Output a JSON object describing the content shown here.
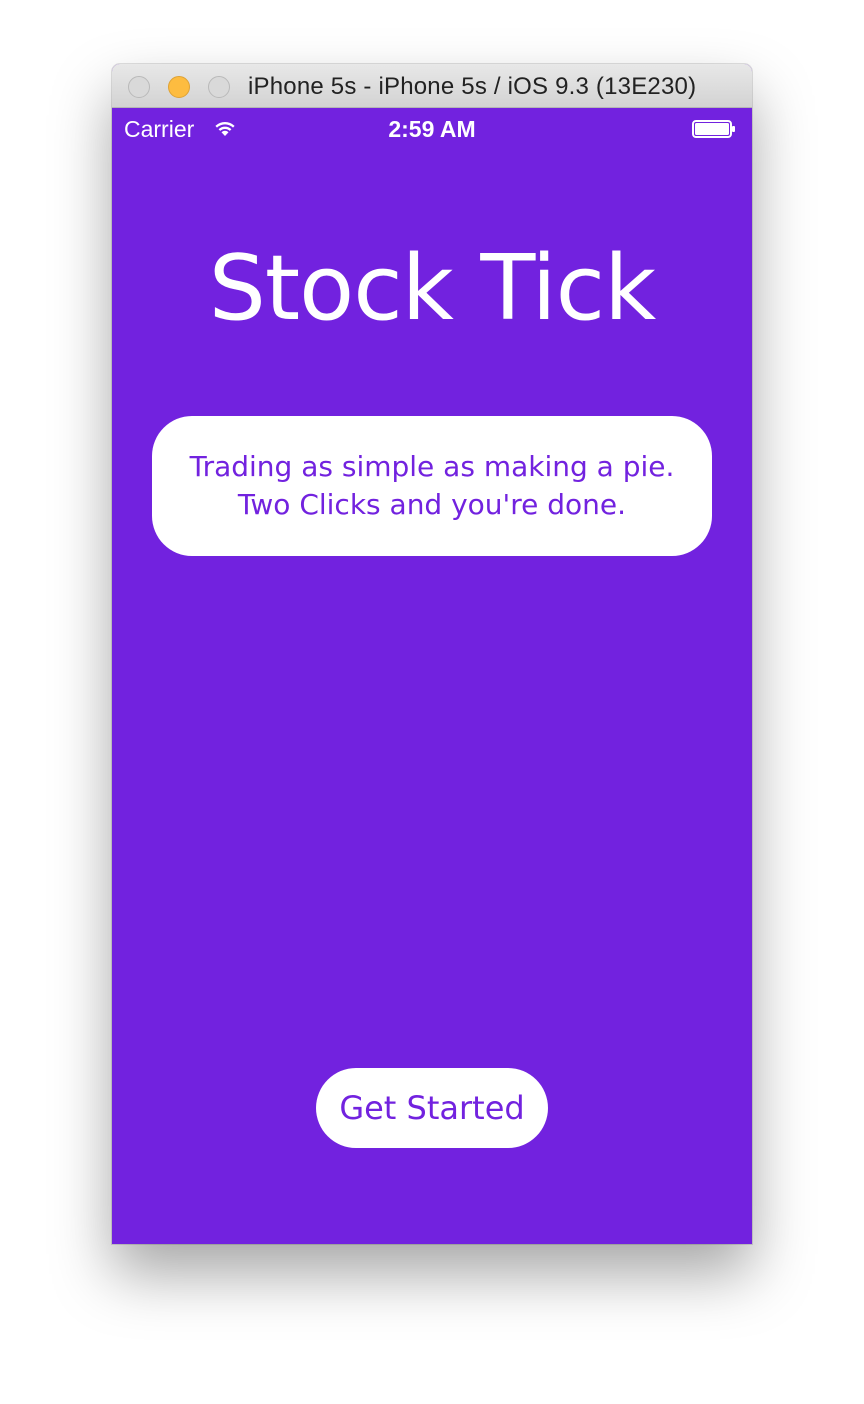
{
  "window": {
    "title": "iPhone 5s - iPhone 5s / iOS 9.3 (13E230)"
  },
  "status_bar": {
    "carrier": "Carrier",
    "time": "2:59 AM",
    "icons": [
      "wifi-icon",
      "battery-icon"
    ]
  },
  "app": {
    "title": "Stock Tick",
    "tagline_line1": "Trading as simple as making a pie.",
    "tagline_line2": "Two Clicks and you're done.",
    "cta_label": "Get Started"
  },
  "colors": {
    "background": "#7222DF",
    "card": "#FFFFFF",
    "accent_text": "#7222DF"
  }
}
